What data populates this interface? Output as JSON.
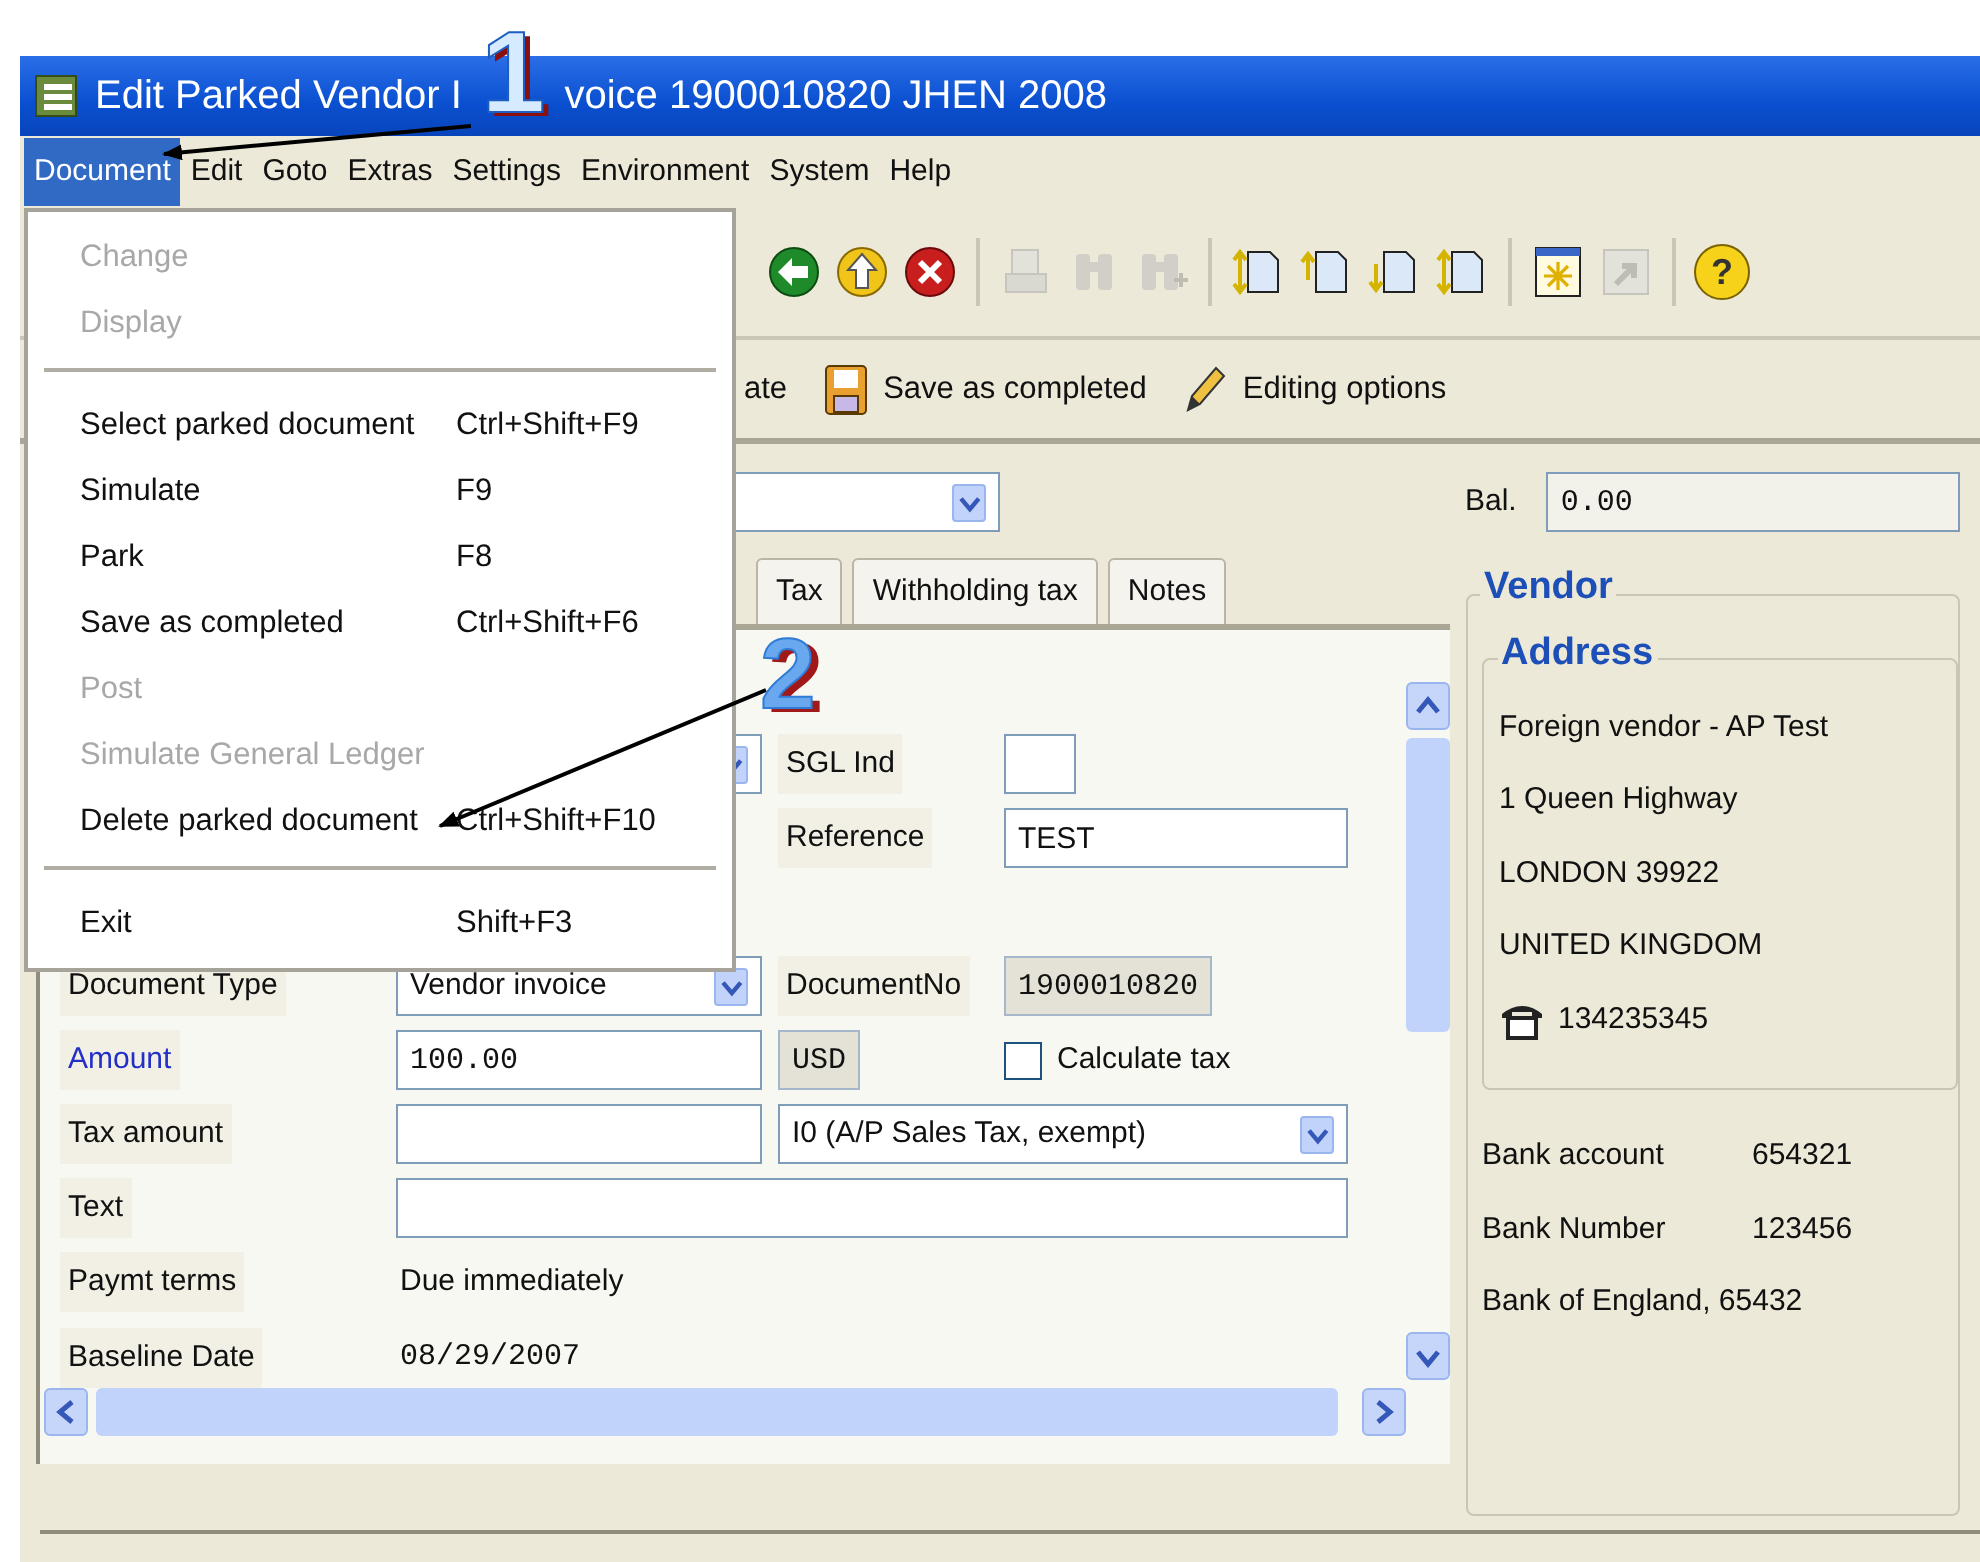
{
  "window": {
    "title_parts": [
      "Edit Parked Vendor I",
      "voice 1900010820 JHEN 2008"
    ]
  },
  "menu_bar": [
    {
      "label": "Document",
      "selected": true
    },
    {
      "label": "Edit",
      "selected": false
    },
    {
      "label": "Goto",
      "selected": false
    },
    {
      "label": "Extras",
      "selected": false
    },
    {
      "label": "Settings",
      "selected": false
    },
    {
      "label": "Environment",
      "selected": false
    },
    {
      "label": "System",
      "selected": false
    },
    {
      "label": "Help",
      "selected": false
    }
  ],
  "dropdown_menu": {
    "items": [
      {
        "kind": "item",
        "label": "Change",
        "disabled": true
      },
      {
        "kind": "item",
        "label": "Display",
        "disabled": true
      },
      {
        "kind": "separator"
      },
      {
        "kind": "item",
        "label": "Select parked document",
        "shortcut": "Ctrl+Shift+F9",
        "disabled": false
      },
      {
        "kind": "item",
        "label": "Simulate",
        "shortcut": "F9",
        "disabled": false
      },
      {
        "kind": "item",
        "label": "Park",
        "shortcut": "F8",
        "disabled": false
      },
      {
        "kind": "item",
        "label": "Save as completed",
        "shortcut": "Ctrl+Shift+F6",
        "disabled": false
      },
      {
        "kind": "item",
        "label": "Post",
        "disabled": true
      },
      {
        "kind": "item",
        "label": "Simulate General Ledger",
        "disabled": true
      },
      {
        "kind": "item",
        "label": "Delete parked document",
        "shortcut": "Ctrl+Shift+F10",
        "disabled": false
      },
      {
        "kind": "separator"
      },
      {
        "kind": "item",
        "label": "Exit",
        "shortcut": "Shift+F3",
        "disabled": false
      }
    ]
  },
  "toolbar": [
    {
      "kind": "back",
      "disabled": false
    },
    {
      "kind": "exit",
      "disabled": false
    },
    {
      "kind": "cancel",
      "disabled": false
    },
    {
      "kind": "separator"
    },
    {
      "kind": "print",
      "disabled": true
    },
    {
      "kind": "find",
      "disabled": true
    },
    {
      "kind": "find_next",
      "disabled": true
    },
    {
      "kind": "separator"
    },
    {
      "kind": "first_page",
      "disabled": false
    },
    {
      "kind": "previous_page",
      "disabled": false
    },
    {
      "kind": "next_page",
      "disabled": false
    },
    {
      "kind": "last_page",
      "disabled": false
    },
    {
      "kind": "separator"
    },
    {
      "kind": "new_session",
      "disabled": false
    },
    {
      "kind": "shortcut",
      "disabled": true
    },
    {
      "kind": "separator"
    },
    {
      "kind": "help",
      "label": "?",
      "disabled": false
    }
  ],
  "app_toolbar": [
    {
      "kind": "text",
      "label": "ate"
    },
    {
      "kind": "save",
      "label": "Save as completed"
    },
    {
      "kind": "edit",
      "label": "Editing options"
    }
  ],
  "balance": {
    "label": "Bal.",
    "value": "0.00"
  },
  "tabs": [
    {
      "label": "Tax",
      "selected": false
    },
    {
      "label": "Withholding tax",
      "selected": false
    },
    {
      "label": "Notes",
      "selected": false
    }
  ],
  "form": {
    "upper_rows": [
      [
        {
          "kind": "gap"
        },
        {
          "kind": "dropdown"
        },
        {
          "kind": "label",
          "text": "SGL Ind"
        },
        {
          "kind": "smallfield"
        }
      ],
      [
        {
          "kind": "gap"
        },
        {
          "kind": "gap"
        },
        {
          "kind": "label",
          "text": "Reference"
        },
        {
          "kind": "field",
          "value": "TEST"
        }
      ]
    ],
    "lower_rows": [
      [
        {
          "kind": "label",
          "text": "Document Type"
        },
        {
          "kind": "dropdown",
          "value": "Vendor invoice"
        },
        {
          "kind": "label",
          "text": "DocumentNo"
        },
        {
          "kind": "output",
          "value": "1900010820"
        }
      ],
      [
        {
          "kind": "linklabel",
          "text": "Amount"
        },
        {
          "kind": "field",
          "value": "100.00"
        },
        {
          "kind": "output",
          "value": "USD"
        },
        {
          "kind": "checkbox",
          "text": "Calculate tax",
          "checked": false
        }
      ],
      [
        {
          "kind": "label",
          "text": "Tax amount"
        },
        {
          "kind": "field"
        },
        {
          "kind": "dropdown",
          "value": "I0 (A/P Sales Tax, exempt)"
        }
      ],
      [
        {
          "kind": "label",
          "text": "Text"
        },
        {
          "kind": "field"
        }
      ],
      [
        {
          "kind": "label",
          "text": "Paymt terms"
        },
        {
          "kind": "static",
          "value": "Due immediately"
        }
      ],
      [
        {
          "kind": "label",
          "text": "Baseline Date"
        },
        {
          "kind": "static",
          "value": "08/29/2007"
        }
      ]
    ]
  },
  "vendor": {
    "title": "Vendor",
    "address": {
      "title": "Address",
      "lines": [
        "Foreign vendor - AP Test",
        "1 Queen Highway",
        "LONDON 39922",
        "UNITED KINGDOM"
      ],
      "phone": "134235345"
    },
    "bank": [
      {
        "label": "Bank account",
        "value": "654321"
      },
      {
        "label": "Bank Number",
        "value": "123456"
      }
    ],
    "bank_name": "Bank of England, 65432"
  },
  "annotations": [
    {
      "label": "1"
    },
    {
      "label": "2"
    }
  ]
}
